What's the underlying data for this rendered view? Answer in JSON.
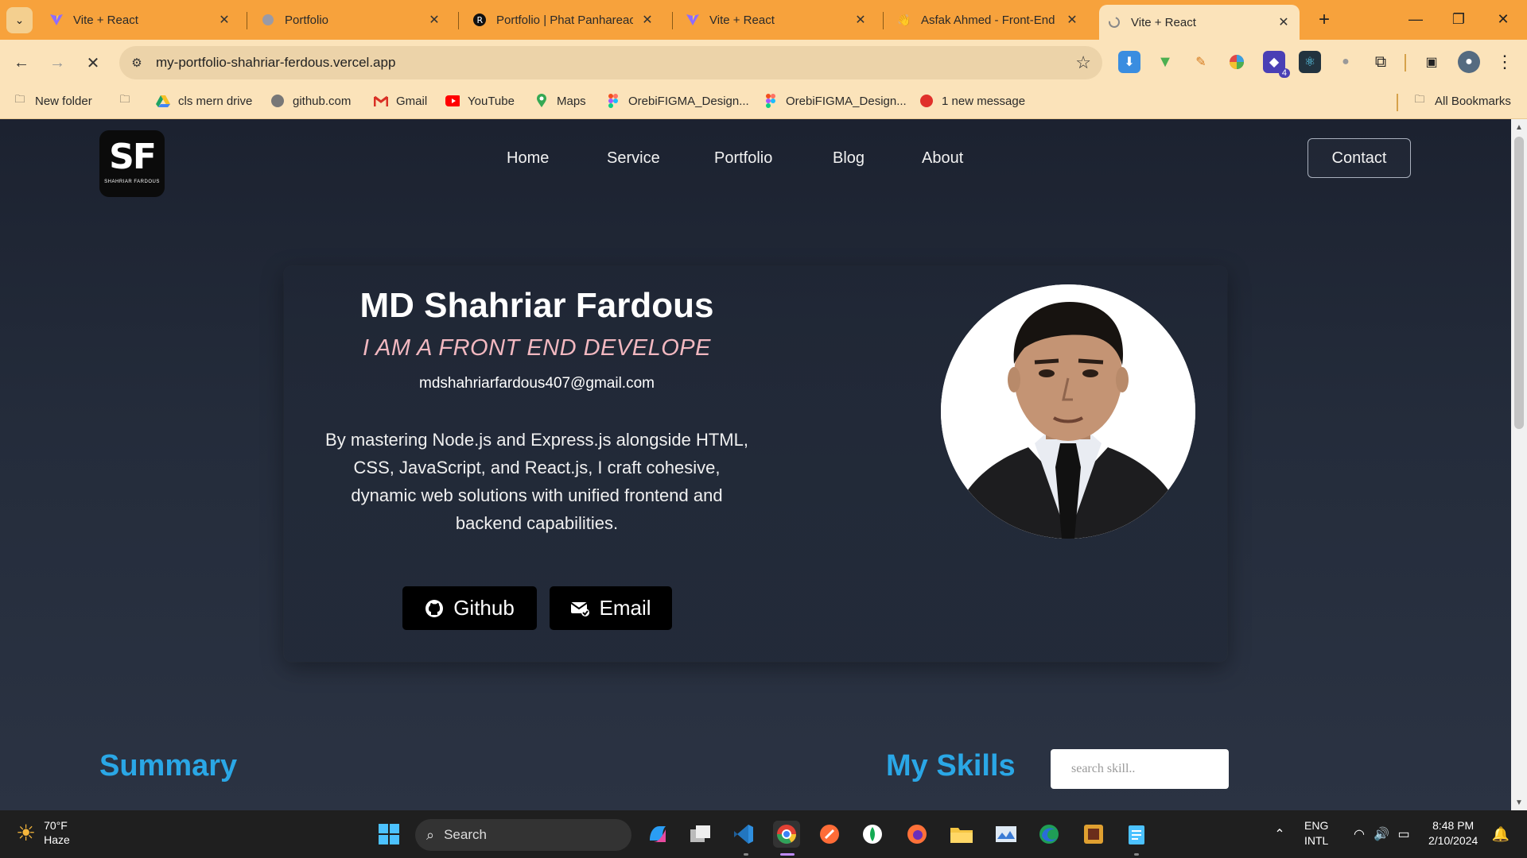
{
  "browser": {
    "tabs": [
      {
        "title": "Vite + React",
        "favicon": "vite-icon"
      },
      {
        "title": "Portfolio",
        "favicon": "globe-icon"
      },
      {
        "title": "Portfolio | Phat Panhareach",
        "favicon": "r-logo-icon"
      },
      {
        "title": "Vite + React",
        "favicon": "vite-icon"
      },
      {
        "title": "Asfak Ahmed - Front-End \\",
        "favicon": "hand-icon"
      },
      {
        "title": "Vite + React",
        "favicon": "loading-icon"
      }
    ],
    "url": "my-portfolio-shahriar-ferdous.vercel.app",
    "bookmarks": [
      {
        "label": "New folder",
        "icon": "folder-icon"
      },
      {
        "label": "",
        "icon": "folder-icon"
      },
      {
        "label": "cls mern drive",
        "icon": "google-drive-icon"
      },
      {
        "label": "github.com",
        "icon": "github-icon"
      },
      {
        "label": "Gmail",
        "icon": "gmail-icon"
      },
      {
        "label": "YouTube",
        "icon": "youtube-icon"
      },
      {
        "label": "Maps",
        "icon": "maps-icon"
      },
      {
        "label": "OrebiFIGMA_Design...",
        "icon": "figma-icon"
      },
      {
        "label": "OrebiFIGMA_Design...",
        "icon": "figma-icon"
      },
      {
        "label": "1 new message",
        "icon": "message-icon"
      }
    ],
    "all_bookmarks": "All Bookmarks",
    "extension_badge": "4"
  },
  "site": {
    "logo_text": "SF",
    "logo_subtext": "SHAHRIAR FARDOUS",
    "nav": [
      "Home",
      "Service",
      "Portfolio",
      "Blog",
      "About"
    ],
    "contact_label": "Contact",
    "hero": {
      "name": "MD Shahriar Fardous",
      "role": "I AM A FRONT END DEVELOPE",
      "email": "mdshahriarfardous407@gmail.com",
      "description": "By mastering Node.js and Express.js alongside HTML, CSS, JavaScript, and React.js, I craft cohesive, dynamic web solutions with unified frontend and backend capabilities.",
      "github_label": "Github",
      "email_label": "Email"
    },
    "summary_title": "Summary",
    "skills_title": "My Skills",
    "skill_search_placeholder": "search skill.."
  },
  "taskbar": {
    "temperature": "70°F",
    "weather": "Haze",
    "search_label": "Search",
    "language": "ENG",
    "keyboard": "INTL",
    "time": "8:48 PM",
    "date": "2/10/2024"
  },
  "colors": {
    "tab_strip": "#f7a23c",
    "toolbar": "#fbe3ba",
    "page_bg": "#1e2533",
    "accent_blue": "#2aa7e6",
    "role_pink": "#f2b8c0"
  }
}
